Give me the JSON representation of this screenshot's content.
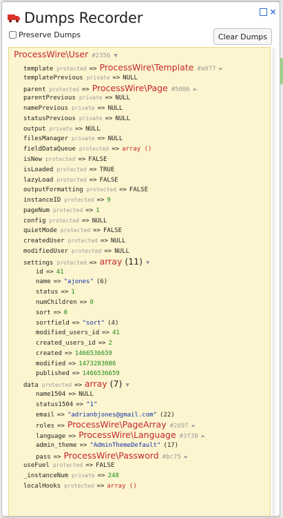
{
  "window": {
    "title": "Dumps Recorder",
    "preserve_label": "Preserve Dumps",
    "clear_label": "Clear Dumps"
  },
  "colors": {
    "panel_bg": "#ffffff",
    "dump_bg": "#fcf5cf",
    "class_red": "#c4262e",
    "number_green": "#1a8a18",
    "string_blue": "#1330a8",
    "accent_blue": "#2e6fd1"
  },
  "dump": {
    "root_class": "ProcessWire\\User",
    "root_hash": "#2356",
    "lines": [
      {
        "indent": 1,
        "key": "template",
        "mod": "protected",
        "type": "class",
        "value": "ProcessWire\\Template",
        "hash": "#a977",
        "tri": "►"
      },
      {
        "indent": 1,
        "key": "templatePrevious",
        "mod": "private",
        "type": "null",
        "value": "NULL"
      },
      {
        "indent": 1,
        "key": "parent",
        "mod": "protected",
        "type": "class",
        "value": "ProcessWire\\Page",
        "hash": "#5086",
        "tri": "►"
      },
      {
        "indent": 1,
        "key": "parentPrevious",
        "mod": "private",
        "type": "null",
        "value": "NULL"
      },
      {
        "indent": 1,
        "key": "namePrevious",
        "mod": "private",
        "type": "null",
        "value": "NULL"
      },
      {
        "indent": 1,
        "key": "statusPrevious",
        "mod": "private",
        "type": "null",
        "value": "NULL"
      },
      {
        "indent": 1,
        "key": "output",
        "mod": "private",
        "type": "null",
        "value": "NULL"
      },
      {
        "indent": 1,
        "key": "filesManager",
        "mod": "private",
        "type": "null",
        "value": "NULL"
      },
      {
        "indent": 1,
        "key": "fieldDataQueue",
        "mod": "protected",
        "type": "arr",
        "value": "array ()"
      },
      {
        "indent": 1,
        "key": "isNew",
        "mod": "protected",
        "type": "bool",
        "value": "FALSE"
      },
      {
        "indent": 1,
        "key": "isLoaded",
        "mod": "protected",
        "type": "bool",
        "value": "TRUE"
      },
      {
        "indent": 1,
        "key": "lazyLoad",
        "mod": "protected",
        "type": "bool",
        "value": "FALSE"
      },
      {
        "indent": 1,
        "key": "outputFormatting",
        "mod": "protected",
        "type": "bool",
        "value": "FALSE"
      },
      {
        "indent": 1,
        "key": "instanceID",
        "mod": "protected",
        "type": "num",
        "value": "9"
      },
      {
        "indent": 1,
        "key": "pageNum",
        "mod": "protected",
        "type": "num",
        "value": "1"
      },
      {
        "indent": 1,
        "key": "config",
        "mod": "protected",
        "type": "null",
        "value": "NULL"
      },
      {
        "indent": 1,
        "key": "quietMode",
        "mod": "protected",
        "type": "bool",
        "value": "FALSE"
      },
      {
        "indent": 1,
        "key": "createdUser",
        "mod": "protected",
        "type": "null",
        "value": "NULL"
      },
      {
        "indent": 1,
        "key": "modifiedUser",
        "mod": "protected",
        "type": "null",
        "value": "NULL"
      },
      {
        "indent": 1,
        "key": "settings",
        "mod": "protected",
        "type": "bigarr",
        "value": "array",
        "count": "(11)",
        "tri": "▼"
      },
      {
        "indent": 2,
        "key": "id",
        "mod": "",
        "type": "num",
        "value": "41"
      },
      {
        "indent": 2,
        "key": "name",
        "mod": "",
        "type": "str",
        "value": "\"ajones\"",
        "count": "(6)"
      },
      {
        "indent": 2,
        "key": "status",
        "mod": "",
        "type": "num",
        "value": "1"
      },
      {
        "indent": 2,
        "key": "numChildren",
        "mod": "",
        "type": "num",
        "value": "0"
      },
      {
        "indent": 2,
        "key": "sort",
        "mod": "",
        "type": "num",
        "value": "0"
      },
      {
        "indent": 2,
        "key": "sortfield",
        "mod": "",
        "type": "str",
        "value": "\"sort\"",
        "count": "(4)"
      },
      {
        "indent": 2,
        "key": "modified_users_id",
        "mod": "",
        "type": "num",
        "value": "41"
      },
      {
        "indent": 2,
        "key": "created_users_id",
        "mod": "",
        "type": "num",
        "value": "2"
      },
      {
        "indent": 2,
        "key": "created",
        "mod": "",
        "type": "num",
        "value": "1466536659"
      },
      {
        "indent": 2,
        "key": "modified",
        "mod": "",
        "type": "num",
        "value": "1473203086"
      },
      {
        "indent": 2,
        "key": "published",
        "mod": "",
        "type": "num",
        "value": "1466536659"
      },
      {
        "indent": 1,
        "key": "data",
        "mod": "protected",
        "type": "bigarr",
        "value": "array",
        "count": "(7)",
        "tri": "▼"
      },
      {
        "indent": 2,
        "key": "name1504",
        "mod": "",
        "type": "null",
        "value": "NULL"
      },
      {
        "indent": 2,
        "key": "status1504",
        "mod": "",
        "type": "str",
        "value": "\"1\""
      },
      {
        "indent": 2,
        "key": "email",
        "mod": "",
        "type": "str",
        "value": "\"adrianbjones@gmail.com\"",
        "count": "(22)"
      },
      {
        "indent": 2,
        "key": "roles",
        "mod": "",
        "type": "class",
        "value": "ProcessWire\\PageArray",
        "hash": "#2697",
        "tri": "►"
      },
      {
        "indent": 2,
        "key": "language",
        "mod": "",
        "type": "class",
        "value": "ProcessWire\\Language",
        "hash": "#3f30",
        "tri": "►"
      },
      {
        "indent": 2,
        "key": "admin_theme",
        "mod": "",
        "type": "str",
        "value": "\"AdminThemeDefault\"",
        "count": "(17)"
      },
      {
        "indent": 2,
        "key": "pass",
        "mod": "",
        "type": "class",
        "value": "ProcessWire\\Password",
        "hash": "#bc75",
        "tri": "►"
      },
      {
        "indent": 1,
        "key": "useFuel",
        "mod": "protected",
        "type": "bool",
        "value": "FALSE"
      },
      {
        "indent": 1,
        "key": "_instanceNum",
        "mod": "private",
        "type": "num",
        "value": "248"
      },
      {
        "indent": 1,
        "key": "localHooks",
        "mod": "protected",
        "type": "arr",
        "value": "array ()"
      }
    ]
  }
}
